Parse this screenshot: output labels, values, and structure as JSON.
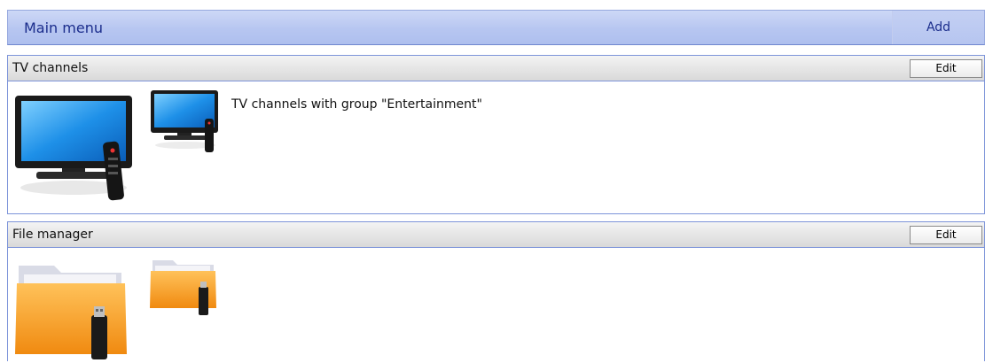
{
  "header": {
    "title": "Main menu",
    "add_label": "Add"
  },
  "sections": [
    {
      "title": "TV channels",
      "edit_label": "Edit",
      "item_text": "TV channels with group \"Entertainment\"",
      "icon_large": "tv-with-remote-icon",
      "icon_small": "tv-with-remote-small-icon"
    },
    {
      "title": "File manager",
      "edit_label": "Edit",
      "icon_large": "folder-usb-icon",
      "icon_small": "folder-usb-small-icon"
    }
  ],
  "colors": {
    "header_bg": "#b7c6f1",
    "header_text": "#1b2d8c",
    "border": "#7d94d9",
    "folder_orange": "#f39a1a",
    "tv_screen": "#1e90e8"
  }
}
